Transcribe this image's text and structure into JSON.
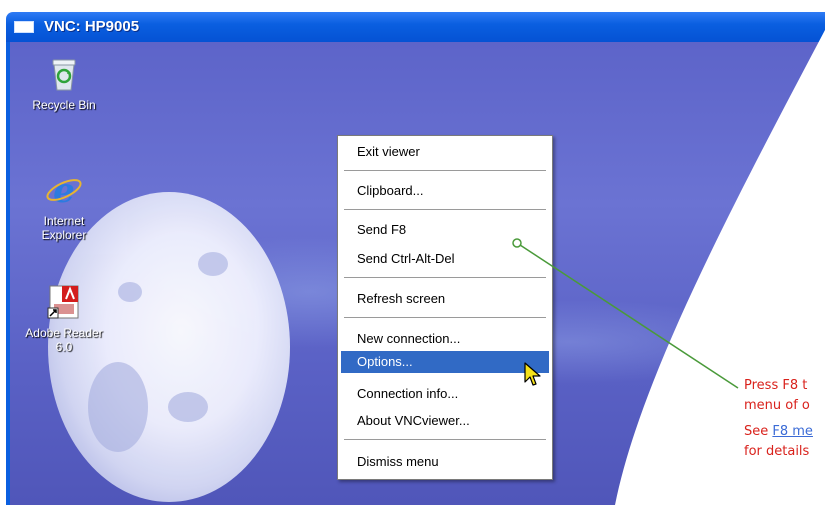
{
  "window": {
    "title": "VNC: HP9005"
  },
  "desktop_icons": [
    {
      "label": "Recycle Bin",
      "icon": "recycle-bin-icon"
    },
    {
      "label_line1": "Internet",
      "label_line2": "Explorer",
      "icon": "internet-explorer-icon"
    },
    {
      "label_line1": "Adobe Reader",
      "label_line2": "6.0",
      "icon": "adobe-reader-icon"
    }
  ],
  "context_menu": {
    "items": [
      "Exit viewer",
      "Clipboard...",
      "Send F8",
      "Send Ctrl-Alt-Del",
      "Refresh screen",
      "New connection...",
      "Options...",
      "Connection info...",
      "About VNCviewer...",
      "Dismiss menu"
    ],
    "highlighted": "Options..."
  },
  "callout": {
    "line1": "Press F8 t",
    "line2": "menu of o",
    "see_prefix": "See ",
    "see_link": "F8 me",
    "line4": "for details"
  },
  "colors": {
    "title_bar": "#0a5fe0",
    "menu_highlight": "#316ac5",
    "callout_text": "#d9221c",
    "callout_line": "#4a9a3a"
  }
}
